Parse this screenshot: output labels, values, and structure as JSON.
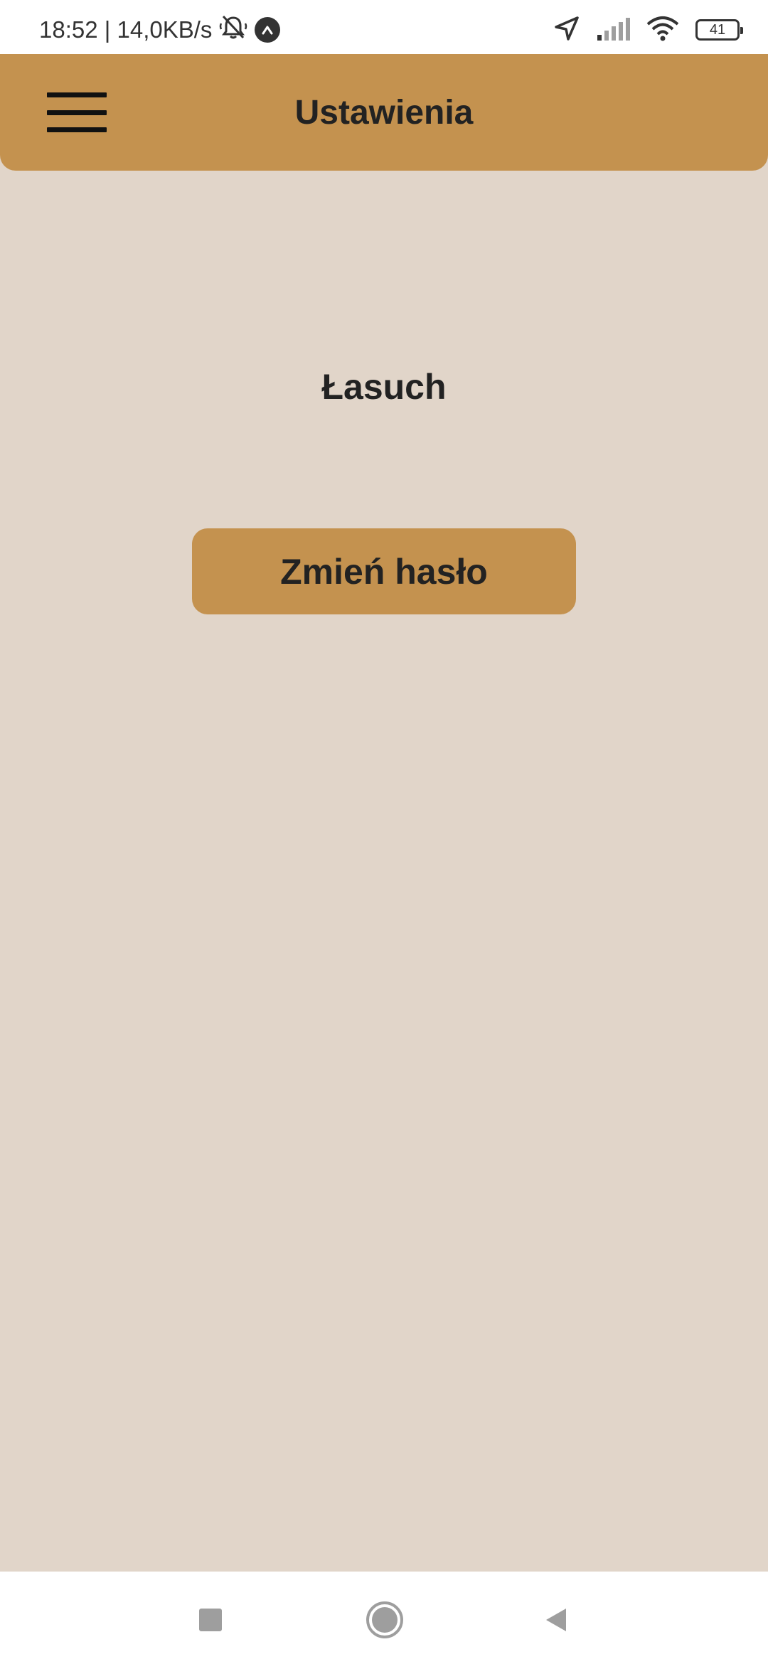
{
  "status_bar": {
    "time_and_speed": "18:52 | 14,0KB/s",
    "battery_level": "41",
    "icons": [
      "bell-off-icon",
      "app-a-icon",
      "location-arrow-icon",
      "signal-icon",
      "wifi-icon",
      "battery-icon"
    ]
  },
  "header": {
    "title": "Ustawienia",
    "menu_icon": "hamburger-menu-icon"
  },
  "main": {
    "username": "Łasuch",
    "change_password_label": "Zmień hasło"
  },
  "nav_bar": {
    "icons": [
      "recents-square-icon",
      "home-circle-icon",
      "back-triangle-icon"
    ]
  },
  "colors": {
    "header_bg": "#c4924f",
    "page_bg": "#e1d5c9",
    "button_bg": "#c4924f",
    "text": "#222222"
  }
}
